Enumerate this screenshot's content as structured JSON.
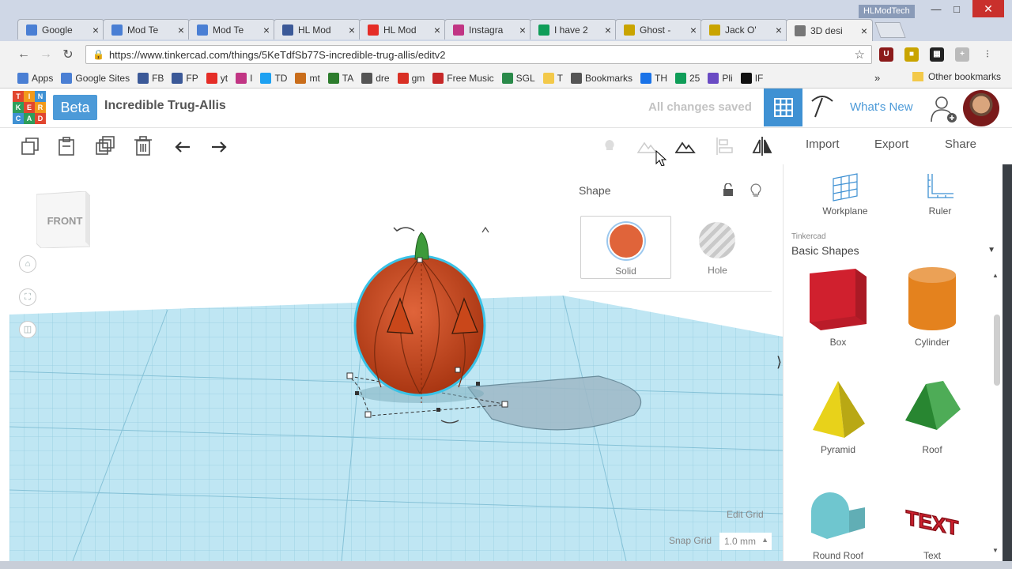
{
  "browser": {
    "tabs": [
      {
        "title": "Google",
        "icon": "doc-icon",
        "color": "#4a7fd4"
      },
      {
        "title": "Mod Te",
        "icon": "doc-icon",
        "color": "#4a7fd4"
      },
      {
        "title": "Mod Te",
        "icon": "doc-icon",
        "color": "#4a7fd4"
      },
      {
        "title": "HL Mod",
        "icon": "facebook-icon",
        "color": "#3b5998"
      },
      {
        "title": "HL Mod",
        "icon": "youtube-icon",
        "color": "#e52d27"
      },
      {
        "title": "Instagra",
        "icon": "instagram-icon",
        "color": "#c13584"
      },
      {
        "title": "I have 2",
        "icon": "sheets-icon",
        "color": "#0f9d58"
      },
      {
        "title": "Ghost -",
        "icon": "thingiverse-icon",
        "color": "#c9a400"
      },
      {
        "title": "Jack O'",
        "icon": "thingiverse-icon",
        "color": "#c9a400"
      },
      {
        "title": "3D desi",
        "icon": "page-icon",
        "color": "#777777"
      }
    ],
    "user": "HLModTech",
    "url": "https://www.tinkercad.com/things/5KeTdfSb77S-incredible-trug-allis/editv2",
    "bookmarks": [
      {
        "label": "Apps",
        "icon": "apps-icon",
        "color": "#4a7fd4"
      },
      {
        "label": "Google Sites",
        "icon": "sites-icon",
        "color": "#4a7fd4"
      },
      {
        "label": "FB",
        "icon": "facebook-icon",
        "color": "#3b5998"
      },
      {
        "label": "FP",
        "icon": "fp-icon",
        "color": "#3b5998"
      },
      {
        "label": "yt",
        "icon": "youtube-icon",
        "color": "#e52d27"
      },
      {
        "label": "I",
        "icon": "instagram-icon",
        "color": "#c13584"
      },
      {
        "label": "TD",
        "icon": "twitter-icon",
        "color": "#1da1f2"
      },
      {
        "label": "mt",
        "icon": "mt-icon",
        "color": "#c96d1b"
      },
      {
        "label": "TA",
        "icon": "ta-icon",
        "color": "#2d7d2d"
      },
      {
        "label": "dre",
        "icon": "dre-icon",
        "color": "#555555"
      },
      {
        "label": "gm",
        "icon": "gmail-icon",
        "color": "#d93025"
      },
      {
        "label": "Free Music",
        "icon": "music-icon",
        "color": "#c62828"
      },
      {
        "label": "SGL",
        "icon": "sgl-icon",
        "color": "#2a8a4a"
      },
      {
        "label": "T",
        "icon": "folder-icon",
        "color": "#f3c94a"
      },
      {
        "label": "Bookmarks",
        "icon": "star-icon",
        "color": "#555555"
      },
      {
        "label": "TH",
        "icon": "th-icon",
        "color": "#1a73e8"
      },
      {
        "label": "25",
        "icon": "sheets-icon",
        "color": "#0f9d58"
      },
      {
        "label": "Pli",
        "icon": "pli-icon",
        "color": "#6a4bc4"
      },
      {
        "label": "IF",
        "icon": "if-icon",
        "color": "#111111"
      }
    ],
    "bookmarks_more": "»",
    "other_bookmarks": "Other bookmarks"
  },
  "app": {
    "logo_letters": [
      "TIN",
      "KER",
      "CAD"
    ],
    "beta": "Beta",
    "title": "Incredible Trug-Allis",
    "saved_status": "All changes saved",
    "whats_new": "What's New",
    "import": "Import",
    "export": "Export",
    "share": "Share"
  },
  "viewcube_label": "FRONT",
  "shape_panel": {
    "title": "Shape",
    "solid_label": "Solid",
    "hole_label": "Hole",
    "solid_color": "#e0643a"
  },
  "grid": {
    "edit_grid": "Edit Grid",
    "snap_grid": "Snap Grid",
    "snap_value": "1.0 mm"
  },
  "library": {
    "workplane": "Workplane",
    "ruler": "Ruler",
    "source": "Tinkercad",
    "category": "Basic Shapes",
    "shapes": [
      {
        "label": "Box",
        "color": "#d0202e"
      },
      {
        "label": "Cylinder",
        "color": "#e4821e"
      },
      {
        "label": "Pyramid",
        "color": "#e8d21a"
      },
      {
        "label": "Roof",
        "color": "#2f9e3a"
      },
      {
        "label": "Round Roof",
        "color": "#6fc6cf"
      },
      {
        "label": "Text",
        "color": "#d0202e"
      }
    ]
  },
  "colors": {
    "accent": "#4c9ad8",
    "grid_plane": "#b8e4f2",
    "pumpkin": "#c9471a",
    "stem": "#3d9a3a"
  }
}
